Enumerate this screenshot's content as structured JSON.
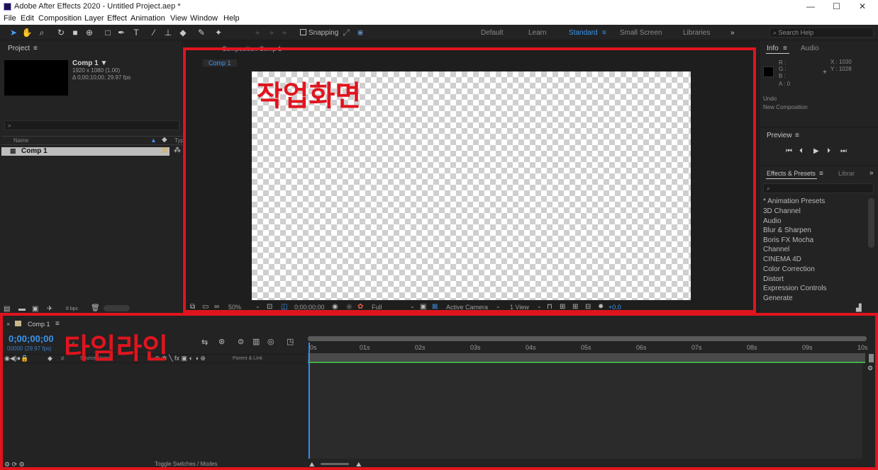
{
  "window": {
    "title": "Adobe After Effects 2020 - Untitled Project.aep *",
    "controls": [
      "—",
      "☐",
      "✕"
    ]
  },
  "menu": [
    "File",
    "Edit",
    "Composition",
    "Layer",
    "Effect",
    "Animation",
    "View",
    "Window",
    "Help"
  ],
  "toolbar": {
    "snapping_label": "Snapping",
    "workspaces": [
      "Default",
      "Learn",
      "Standard",
      "Small Screen",
      "Libraries"
    ],
    "active_workspace": "Standard",
    "search_placeholder": "Search Help"
  },
  "project": {
    "title": "Project",
    "comp_name": "Comp 1 ▼",
    "comp_dims": "1920 x 1080 (1.00)",
    "comp_duration": "Δ 0;00;10;00, 29.97 fps",
    "col_name": "Name",
    "col_type": "Typ",
    "item": "Comp 1",
    "bpc": "8 bpc"
  },
  "composition": {
    "panel_title": "Composition Comp 1",
    "tab": "Comp 1",
    "zoom": "50%",
    "timecode": "0;00;00;00",
    "resolution": "Full",
    "camera": "Active Camera",
    "views": "1 View",
    "exposure": "+0.0"
  },
  "info": {
    "tab_info": "Info",
    "tab_audio": "Audio",
    "r": "R :",
    "g": "G :",
    "b": "B :",
    "a": "A : 0",
    "x": "X : 1030",
    "y": "Y : 1028",
    "undo_label": "Undo",
    "undo_value": "New Composition"
  },
  "preview": {
    "title": "Preview"
  },
  "effects": {
    "tab": "Effects & Presets",
    "tab2": "Librar",
    "items": [
      "* Animation Presets",
      "3D Channel",
      "Audio",
      "Blur & Sharpen",
      "Boris FX Mocha",
      "Channel",
      "CINEMA 4D",
      "Color Correction",
      "Distort",
      "Expression Controls",
      "Generate"
    ]
  },
  "timeline": {
    "tab": "Comp 1",
    "timecode": "0;00;00;00",
    "frame_info": "00000 (29.97 fps)",
    "source_name": "Source Name",
    "parent_link": "Parent & Link",
    "ticks": [
      "0s",
      "01s",
      "02s",
      "03s",
      "04s",
      "05s",
      "06s",
      "07s",
      "08s",
      "09s",
      "10s"
    ],
    "toggle": "Toggle Switches / Modes"
  },
  "annotations": {
    "workspace": "작업화면",
    "timeline": "타임라인"
  },
  "colors": {
    "annotation_red": "#e0141e",
    "accent_blue": "#2d8ceb",
    "work_area_green": "#3fb04a"
  }
}
